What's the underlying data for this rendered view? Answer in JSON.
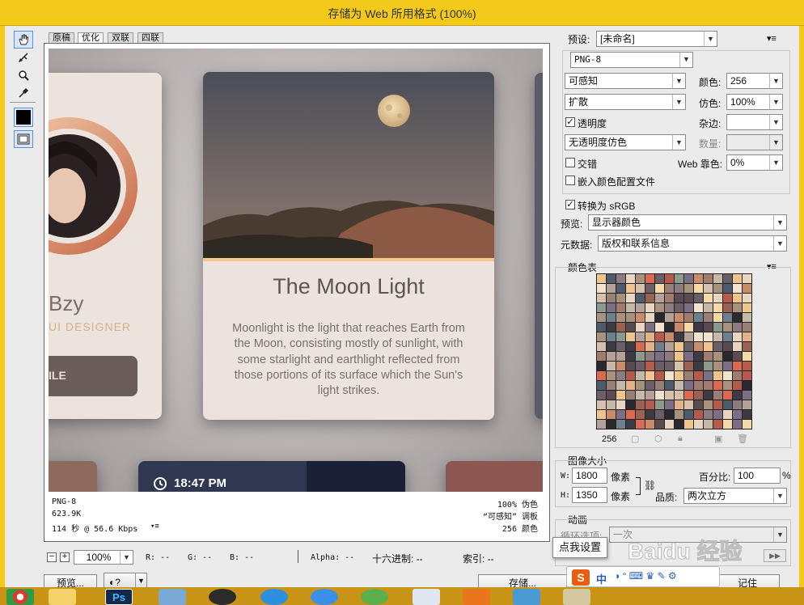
{
  "window": {
    "title": "存储为 Web 所用格式 (100%)"
  },
  "tabs": [
    "原稿",
    "优化",
    "双联",
    "四联"
  ],
  "active_tab": 1,
  "tools": [
    "hand-icon",
    "slice-select-icon",
    "zoom-icon",
    "eyedropper-icon",
    "color-swatch",
    "toggle-slices-icon"
  ],
  "preview_card": {
    "title": "The Moon Light",
    "body": "Moonlight is the light that reaches Earth from the Moon, consisting mostly of sunlight, with some starlight and earthlight reflected from those portions of its surface which the Sun's light strikes."
  },
  "left_card": {
    "name": "Bzy",
    "role": "UI DESIGNER",
    "button": "ILE"
  },
  "bottom_card": {
    "time": "18:47 PM"
  },
  "preview_info": {
    "format": "PNG-8",
    "size": "623.9K",
    "speed": "114 秒 @ 56.6 Kbps",
    "quality": "100% 伪色",
    "palette": "“可感知” 调板",
    "colors": "256 颜色"
  },
  "statusbar": {
    "zoom": "100%",
    "r": "R: --",
    "g": "G: --",
    "b": "B: --",
    "alpha": "Alpha: --",
    "hex": "十六进制: --",
    "index": "索引: --"
  },
  "panel": {
    "preset_label": "预设:",
    "preset_value": "[未命名]",
    "format_value": "PNG-8",
    "reduction_value": "可感知",
    "colors_label": "颜色:",
    "colors_value": "256",
    "dither_algo_value": "扩散",
    "dither_label": "仿色:",
    "dither_value": "100%",
    "transparency_label": "透明度",
    "transparency_checked": true,
    "matte_label": "杂边:",
    "matte_value": "",
    "trans_dither_value": "无透明度仿色",
    "amount_label": "数量:",
    "amount_value": "",
    "interlaced_label": "交错",
    "interlaced_checked": false,
    "websnap_label": "Web 靠色:",
    "websnap_value": "0%",
    "embed_profile_label": "嵌入颜色配置文件",
    "embed_profile_checked": false,
    "convert_srgb_label": "转换为 sRGB",
    "convert_srgb_checked": true,
    "preview_label": "预览:",
    "preview_value": "显示器颜色",
    "metadata_label": "元数据:",
    "metadata_value": "版权和联系信息",
    "color_table_label": "颜色表",
    "color_count": "256",
    "image_size_label": "图像大小",
    "w_label": "W:",
    "w_value": "1800",
    "h_label": "H:",
    "h_value": "1350",
    "px_label": "像素",
    "percent_label": "百分比:",
    "percent_value": "100",
    "percent_unit": "%",
    "quality_label": "品质:",
    "quality_value": "两次立方",
    "animation_label": "动画",
    "loop_label": "循环选项:",
    "loop_value": "一次",
    "tooltip": "点我设置"
  },
  "buttons": {
    "preview": "预览...",
    "save": "存储...",
    "remember": "记住"
  },
  "watermark": "Baidu 经验",
  "ime_label": "中"
}
